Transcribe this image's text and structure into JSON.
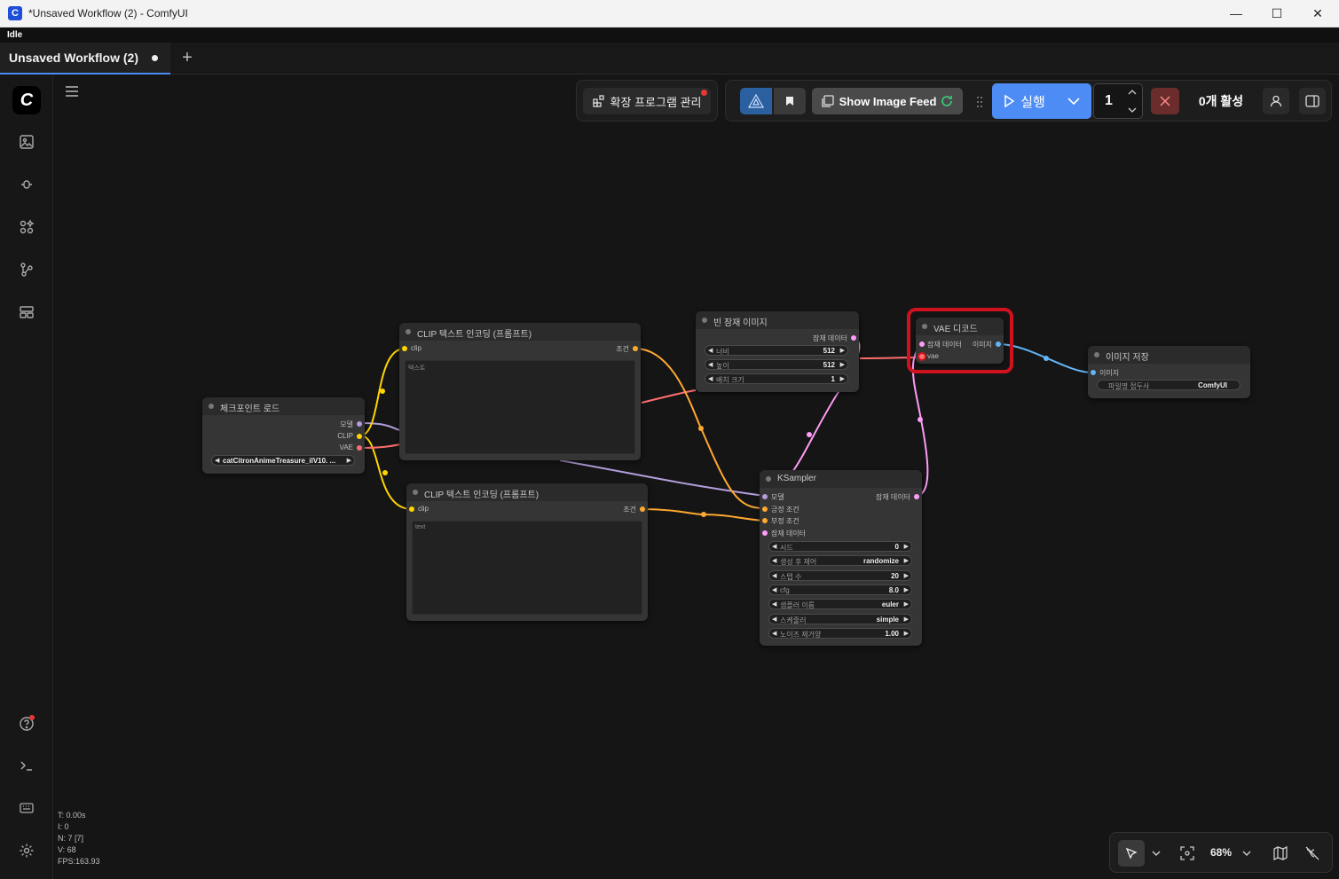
{
  "window": {
    "title": "*Unsaved Workflow (2) - ComfyUI",
    "app_icon": "C",
    "minimize": "—",
    "maximize": "☐",
    "close": "✕"
  },
  "status": "Idle",
  "tabs": [
    {
      "label": "Unsaved Workflow (2)",
      "modified_dot": "●"
    }
  ],
  "new_tab": "+",
  "sidebar": {
    "logo": "C",
    "items": [
      "images",
      "models",
      "node-library",
      "workflows",
      "templates"
    ],
    "bottom": [
      "help",
      "console",
      "keyboard",
      "settings"
    ]
  },
  "toolbar": {
    "extensions_label": "확장 프로그램 관리",
    "show_image_feed": "Show Image Feed",
    "run_label": "실행",
    "queue_count": "1",
    "active_label": "0개 활성"
  },
  "stats": {
    "t": "T: 0.00s",
    "i": "I: 0",
    "n": "N: 7 [7]",
    "v": "V: 68",
    "fps": "FPS:163.93"
  },
  "zoom": "68%",
  "nodes": {
    "checkpoint": {
      "title": "체크포인트 로드",
      "out_model": "모델",
      "out_clip": "CLIP",
      "out_vae": "VAE",
      "ckpt_value": "catCitronAnimeTreasure_ilV10. ..."
    },
    "clip1": {
      "title": "CLIP 텍스트 인코딩 (프롬프트)",
      "in_clip": "clip",
      "out_cond": "조건",
      "text": "텍스트"
    },
    "clip2": {
      "title": "CLIP 텍스트 인코딩 (프롬프트)",
      "in_clip": "clip",
      "out_cond": "조건",
      "text": "text"
    },
    "empty_latent": {
      "title": "빈 잠재 이미지",
      "out_latent": "잠재 데이터",
      "w_label": "너비",
      "w_value": "512",
      "h_label": "높이",
      "h_value": "512",
      "b_label": "배치 크기",
      "b_value": "1"
    },
    "ksampler": {
      "title": "KSampler",
      "in_model": "모델",
      "in_pos": "긍정 조건",
      "in_neg": "부정 조건",
      "in_latent": "잠재 데이터",
      "out_latent": "잠재 데이터",
      "widgets": [
        {
          "label": "시드",
          "value": "0"
        },
        {
          "label": "생성 후 제어",
          "value": "randomize"
        },
        {
          "label": "스텝 수",
          "value": "20"
        },
        {
          "label": "cfg",
          "value": "8.0"
        },
        {
          "label": "샘플러 이름",
          "value": "euler"
        },
        {
          "label": "스케줄러",
          "value": "simple"
        },
        {
          "label": "노이즈 제거양",
          "value": "1.00"
        }
      ]
    },
    "vae_decode": {
      "title": "VAE 디코드",
      "in_latent": "잠재 데이터",
      "in_vae": "vae",
      "out_image": "이미지"
    },
    "save_image": {
      "title": "이미지 저장",
      "in_images": "이미지",
      "prefix_label": "파일명 접두사",
      "prefix_value": "ComfyUI"
    }
  },
  "colors": {
    "accent": "#4d8cf5",
    "highlight": "#d0121e",
    "link_model": "#b39ddb",
    "link_clip": "#ffd500",
    "link_vae": "#ff6e6e",
    "link_cond": "#ffa931",
    "link_latent": "#ff9cf9",
    "link_image": "#64b5f6"
  }
}
